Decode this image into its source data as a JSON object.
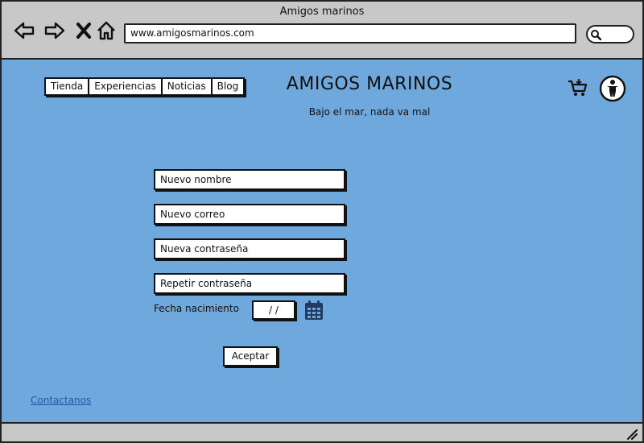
{
  "window": {
    "title": "Amigos marinos"
  },
  "browser": {
    "url": "www.amigosmarinos.com",
    "icons": [
      "back-arrow-icon",
      "forward-arrow-icon",
      "close-x-icon",
      "home-icon",
      "search-icon"
    ]
  },
  "nav": {
    "items": [
      {
        "label": "Tienda"
      },
      {
        "label": "Experiencias"
      },
      {
        "label": "Noticias"
      },
      {
        "label": "Blog"
      }
    ]
  },
  "header": {
    "title": "AMIGOS MARINOS",
    "tagline": "Bajo el mar, nada va mal",
    "icons": [
      "cart-icon",
      "user-icon"
    ]
  },
  "form": {
    "name_placeholder": "Nuevo nombre",
    "email_placeholder": "Nuevo correo",
    "password_placeholder": "Nueva contraseña",
    "repeat_password_placeholder": "Repetir contraseña",
    "dob_label": "Fecha nacimiento",
    "dob_value": "/ /",
    "submit_label": "Aceptar"
  },
  "footer": {
    "contact_label": "Contactanos"
  },
  "colors": {
    "page_bg": "#6fa8dc",
    "chrome_bg": "#c8c8c8",
    "link": "#1c5aa6"
  }
}
